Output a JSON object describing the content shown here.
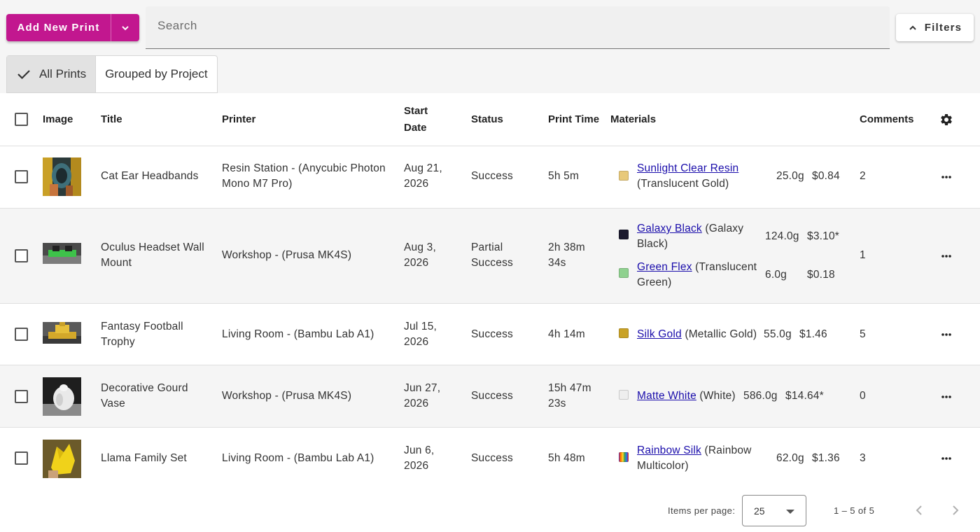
{
  "toolbar": {
    "add_label": "Add New Print",
    "search_placeholder": "Search",
    "filters_label": "Filters"
  },
  "view_toggle": {
    "all_label": "All Prints",
    "grouped_label": "Grouped by Project"
  },
  "table": {
    "headers": {
      "image": "Image",
      "title": "Title",
      "printer": "Printer",
      "start_date_line1": "Start",
      "start_date_line2": "Date",
      "status": "Status",
      "print_time": "Print Time",
      "materials": "Materials",
      "comments": "Comments"
    },
    "rows": [
      {
        "title_line1": "Cat Ear Headbands",
        "title_line2": "",
        "printer_line1": "Resin Station - (Anycubic Photon",
        "printer_line2": "Mono M7 Pro)",
        "date_line1": "Aug 21,",
        "date_line2": "2026",
        "status_line1": "Success",
        "status_line2": "",
        "time_line1": "5h 5m",
        "time_line2": "",
        "materials": [
          {
            "color": "#e8c97a",
            "name": "Sunlight Clear Resin",
            "detail_line1": "",
            "detail_line2": "(Translucent Gold)",
            "weight": "25.0g",
            "cost": "$0.84"
          }
        ],
        "comments": "2"
      },
      {
        "title_line1": "Oculus Headset Wall",
        "title_line2": "Mount",
        "printer_line1": "Workshop - (Prusa MK4S)",
        "printer_line2": "",
        "date_line1": "Aug 3,",
        "date_line2": "2026",
        "status_line1": "Partial",
        "status_line2": "Success",
        "time_line1": "2h 38m",
        "time_line2": "34s",
        "materials": [
          {
            "color": "#1b1a2e",
            "name": "Galaxy Black",
            "detail_line1": " (Galaxy",
            "detail_line2": "Black)",
            "weight": "124.0g",
            "cost": "$3.10*"
          },
          {
            "color": "#8fd18f",
            "name": "Green Flex",
            "detail_line1": " (Translucent",
            "detail_line2": "Green)",
            "weight": "6.0g",
            "cost": "$0.18"
          }
        ],
        "comments": "1"
      },
      {
        "title_line1": "Fantasy Football",
        "title_line2": "Trophy",
        "printer_line1": "Living Room - (Bambu Lab A1)",
        "printer_line2": "",
        "date_line1": "Jul 15,",
        "date_line2": "2026",
        "status_line1": "Success",
        "status_line2": "",
        "time_line1": "4h 14m",
        "time_line2": "",
        "materials": [
          {
            "color": "#c9a227",
            "name": "Silk Gold",
            "detail_line1": " (Metallic Gold)",
            "detail_line2": "",
            "weight": "55.0g",
            "cost": "$1.46"
          }
        ],
        "comments": "5"
      },
      {
        "title_line1": "Decorative Gourd",
        "title_line2": "Vase",
        "printer_line1": "Workshop - (Prusa MK4S)",
        "printer_line2": "",
        "date_line1": "Jun 27,",
        "date_line2": "2026",
        "status_line1": "Success",
        "status_line2": "",
        "time_line1": "15h 47m",
        "time_line2": "23s",
        "materials": [
          {
            "color": "#eeeeee",
            "name": "Matte White",
            "detail_line1": " (White)",
            "detail_line2": "",
            "weight": "586.0g",
            "cost": "$14.64*"
          }
        ],
        "comments": "0"
      },
      {
        "title_line1": "Llama Family Set",
        "title_line2": "",
        "printer_line1": "Living Room - (Bambu Lab A1)",
        "printer_line2": "",
        "date_line1": "Jun 6,",
        "date_line2": "2026",
        "status_line1": "Success",
        "status_line2": "",
        "time_line1": "5h 48m",
        "time_line2": "",
        "materials": [
          {
            "color": "rainbow",
            "name": "Rainbow Silk",
            "detail_line1": " (Rainbow",
            "detail_line2": "Multicolor)",
            "weight": "62.0g",
            "cost": "$1.36"
          }
        ],
        "comments": "3"
      }
    ]
  },
  "pagination": {
    "items_per_page_label": "Items per page:",
    "items_per_page_value": "25",
    "range_label": "1 – 5 of 5"
  },
  "colors": {
    "accent": "#c2178f",
    "link": "#1a0dab"
  }
}
